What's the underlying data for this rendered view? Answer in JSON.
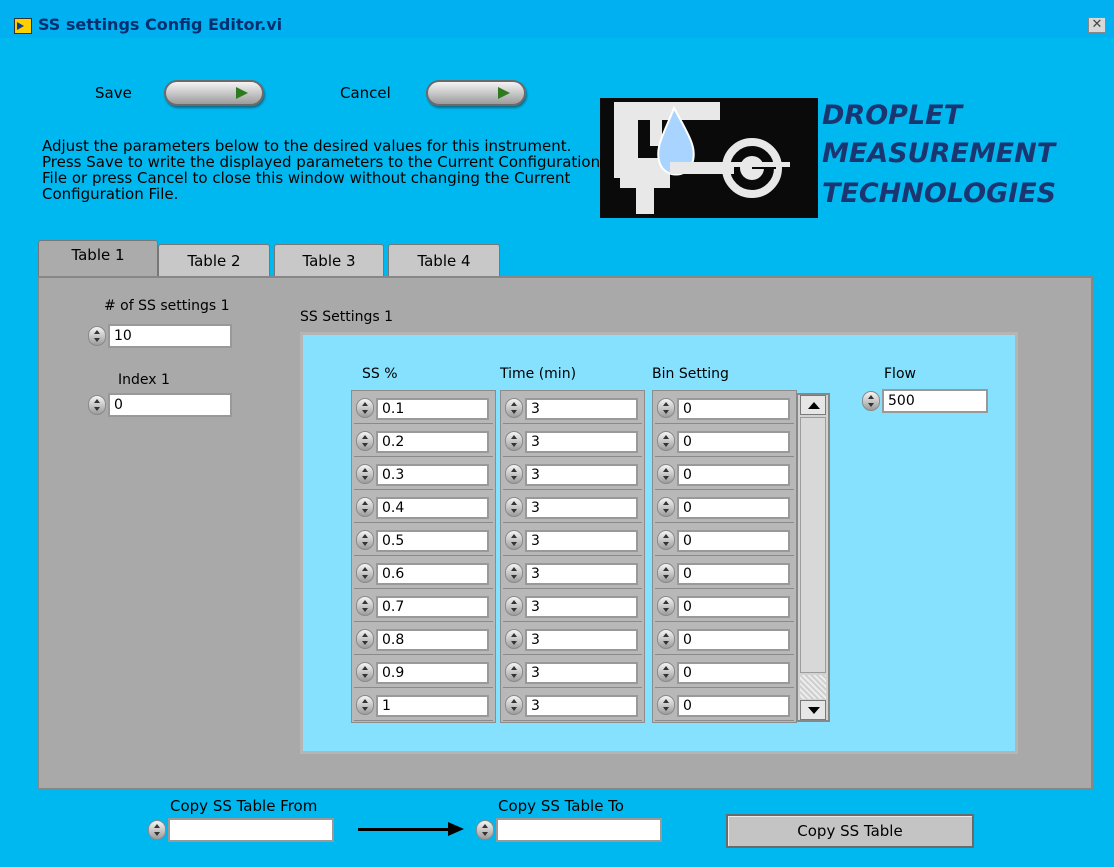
{
  "window": {
    "title": "SS settings Config Editor.vi",
    "close_glyph": "✕"
  },
  "buttons": {
    "save_label": "Save",
    "cancel_label": "Cancel"
  },
  "instructions": "Adjust the parameters below to the desired values for this instrument.  Press Save to write the displayed parameters to the Current Configuration File or press Cancel to close this window without changing the Current Configuration File.",
  "logo": {
    "line1": "DROPLET",
    "line2": "MEASUREMENT",
    "line3": "TECHNOLOGIES"
  },
  "tabs": [
    {
      "label": "Table 1",
      "active": true
    },
    {
      "label": "Table 2",
      "active": false
    },
    {
      "label": "Table 3",
      "active": false
    },
    {
      "label": "Table 4",
      "active": false
    }
  ],
  "panel": {
    "num_settings_label": "# of SS settings 1",
    "num_settings_value": "10",
    "index_label": "Index 1",
    "index_value": "0",
    "cluster_label": "SS Settings 1",
    "col_ss_label": "SS %",
    "col_time_label": "Time (min)",
    "col_bin_label": "Bin Setting",
    "flow_label": "Flow",
    "flow_value": "500",
    "ss_values": [
      "0.1",
      "0.2",
      "0.3",
      "0.4",
      "0.5",
      "0.6",
      "0.7",
      "0.8",
      "0.9",
      "1"
    ],
    "time_values": [
      "3",
      "3",
      "3",
      "3",
      "3",
      "3",
      "3",
      "3",
      "3",
      "3"
    ],
    "bin_values": [
      "0",
      "0",
      "0",
      "0",
      "0",
      "0",
      "0",
      "0",
      "0",
      "0"
    ]
  },
  "copy": {
    "from_label": "Copy SS Table From",
    "from_value": "",
    "to_label": "Copy SS Table To",
    "to_value": "",
    "button_label": "Copy SS Table"
  },
  "colors": {
    "background": "#00b8f0",
    "panel": "#a9a9a9",
    "cluster": "#86e1ff",
    "logo_text": "#1a3570"
  },
  "icons": [
    "labview-vi-icon",
    "close-icon",
    "save-arrow-icon",
    "cancel-arrow-icon",
    "spinner-icon",
    "scroll-up-icon",
    "scroll-down-icon",
    "arrow-right-icon",
    "droplet-logo-icon"
  ]
}
